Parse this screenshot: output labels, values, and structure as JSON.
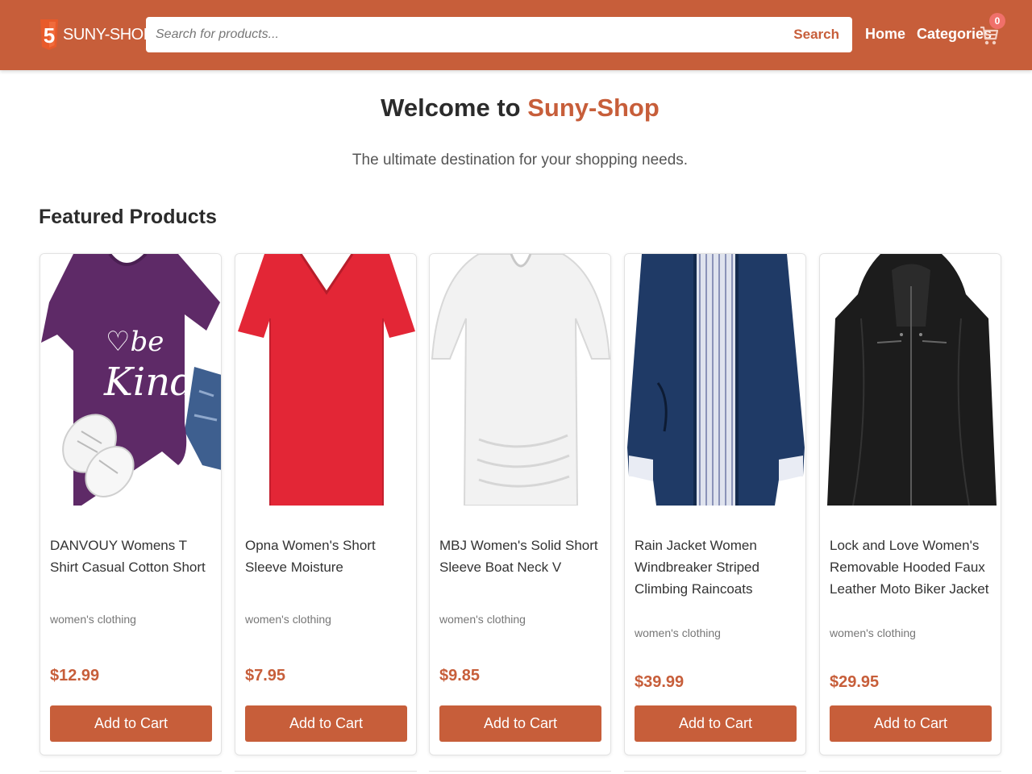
{
  "header": {
    "logo_text": "SUNY-SHOP",
    "search_placeholder": "Search for products...",
    "search_button": "Search",
    "nav_home": "Home",
    "nav_categories": "Categories",
    "cart_count": "0"
  },
  "hero": {
    "welcome": "Welcome to",
    "brand": "Suny-Shop",
    "subtitle": "The ultimate destination for your shopping needs."
  },
  "featured": {
    "title": "Featured Products",
    "add_label": "Add to Cart",
    "products": [
      {
        "name": "DANVOUY Womens T Shirt Casual Cotton Short",
        "category": "women's clothing",
        "price": "$12.99",
        "image": "purple-tshirt-be-kind"
      },
      {
        "name": "Opna Women's Short Sleeve Moisture",
        "category": "women's clothing",
        "price": "$7.95",
        "image": "red-vneck-tshirt"
      },
      {
        "name": "MBJ Women's Solid Short Sleeve Boat Neck V",
        "category": "women's clothing",
        "price": "$9.85",
        "image": "white-boat-neck-top"
      },
      {
        "name": "Rain Jacket Women Windbreaker Striped Climbing Raincoats",
        "category": "women's clothing",
        "price": "$39.99",
        "image": "navy-rain-jacket"
      },
      {
        "name": "Lock and Love Women's Removable Hooded Faux Leather Moto Biker Jacket",
        "category": "women's clothing",
        "price": "$29.95",
        "image": "black-leather-jacket"
      }
    ]
  },
  "colors": {
    "brand": "#c75e3a",
    "cart_badge": "#f0706a"
  }
}
